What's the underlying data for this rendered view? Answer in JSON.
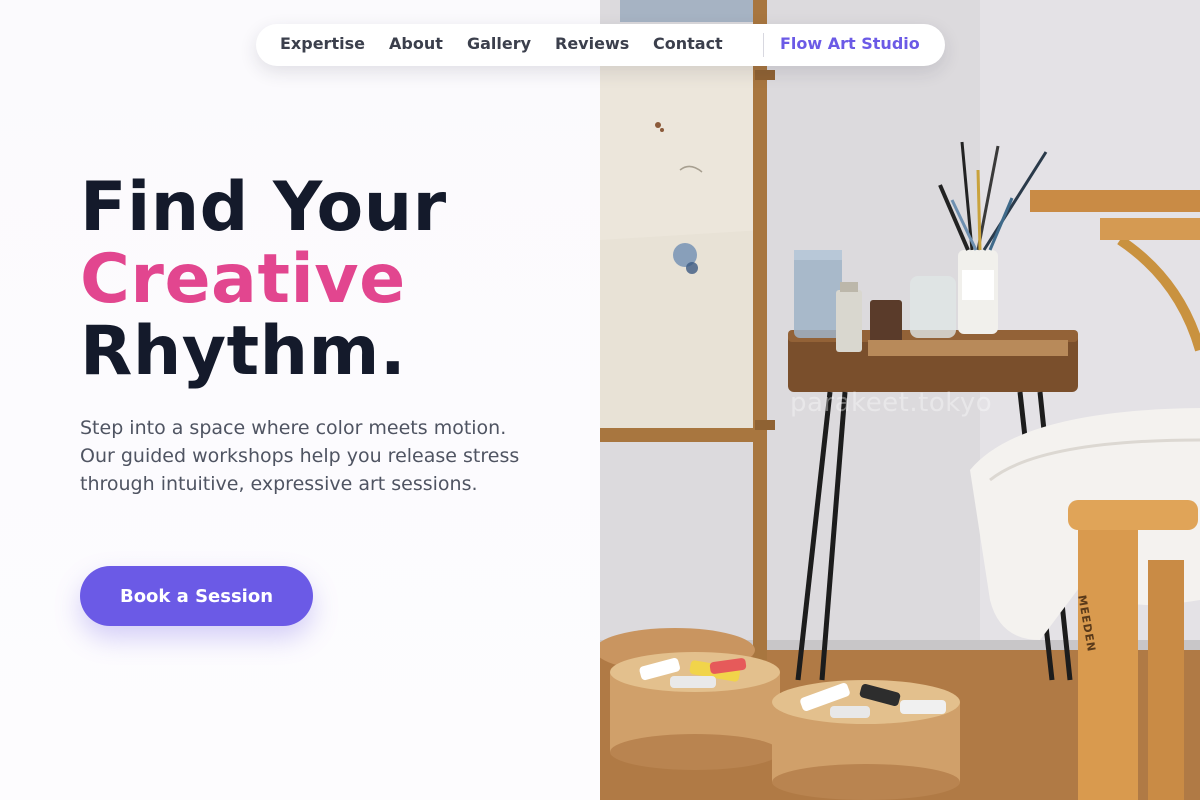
{
  "nav": {
    "links": [
      "Expertise",
      "About",
      "Gallery",
      "Reviews",
      "Contact"
    ],
    "brand": "Flow Art Studio"
  },
  "hero": {
    "headline_line1": "Find Your",
    "headline_accent": "Creative",
    "headline_line3": "Rhythm.",
    "lede": "Step into a space where color meets motion. Our guided workshops help you release stress through intuitive, expressive art sessions.",
    "cta_label": "Book a Session"
  },
  "photo": {
    "watermark": "parakeet.tokyo",
    "stool_brand": "MEEDEN"
  },
  "colors": {
    "accent_purple": "#6b5ae6",
    "accent_pink": "#e2468f",
    "heading": "#141a2b",
    "body_text": "#4f5462"
  }
}
